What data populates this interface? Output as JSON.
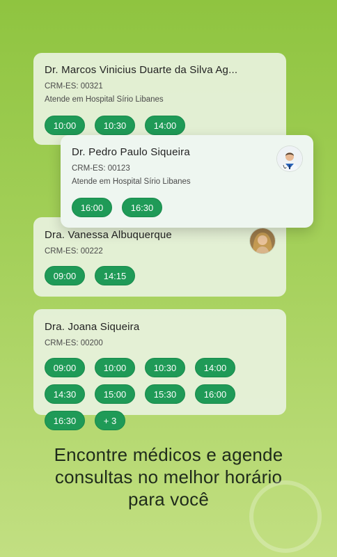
{
  "doctors": [
    {
      "name": "Dr. Marcos Vinicius Duarte da Silva Ag...",
      "crm": "CRM-ES: 00321",
      "hospital": "Atende em Hospital Sírio Libanes",
      "slots": [
        "10:00",
        "10:30",
        "14:00"
      ]
    },
    {
      "name": "Dr. Pedro Paulo Siqueira",
      "crm": "CRM-ES: 00123",
      "hospital": "Atende em Hospital Sírio Libanes",
      "slots": [
        "16:00",
        "16:30"
      ]
    },
    {
      "name": "Dra. Vanessa Albuquerque",
      "crm": "CRM-ES: 00222",
      "slots": [
        "09:00",
        "14:15"
      ]
    },
    {
      "name": "Dra. Joana Siqueira",
      "crm": "CRM-ES: 00200",
      "slots": [
        "09:00",
        "10:00",
        "10:30",
        "14:00",
        "14:30",
        "15:00",
        "15:30",
        "16:00",
        "16:30"
      ],
      "more": "+ 3"
    }
  ],
  "tagline": {
    "line1": "Encontre médicos e agende",
    "line2": "consultas no melhor horário",
    "line3": "para você"
  },
  "colors": {
    "slot": "#1f9a57",
    "background_top": "#8fc440",
    "background_bottom": "#c2df82"
  }
}
